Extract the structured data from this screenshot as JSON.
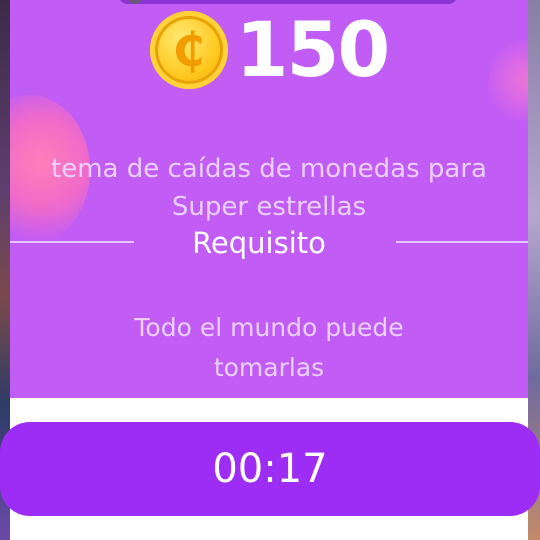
{
  "coin_drop": {
    "icon": "coin-icon",
    "coin_glyph": "₵",
    "amount": "150"
  },
  "description": {
    "line1": "tema de caídas de monedas para",
    "line2": "Super estrellas"
  },
  "requirement": {
    "title": "Requisito",
    "line1": "Todo el mundo puede",
    "line2": "tomarlas"
  },
  "timer": {
    "label": "00:17"
  },
  "colors": {
    "card_background": "#c15cf5",
    "timer_button": "#9d2cf4",
    "coin_gold": "#ffc81e"
  }
}
